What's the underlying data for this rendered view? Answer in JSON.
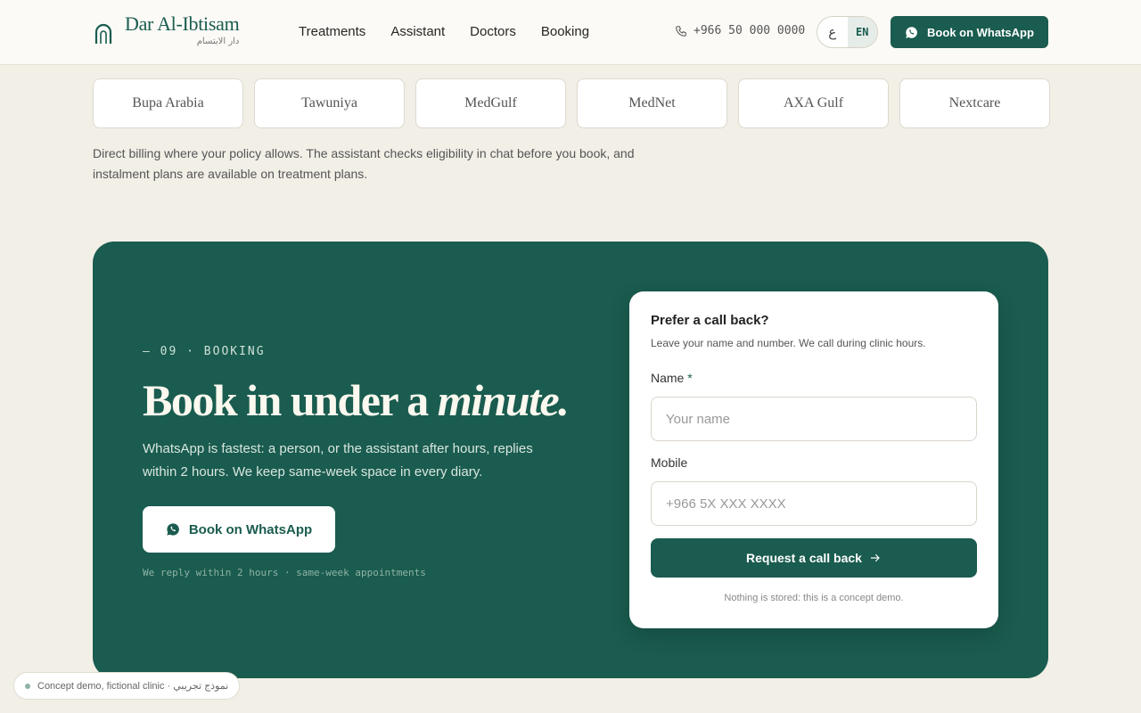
{
  "header": {
    "brand_name": "Dar Al-Ibtisam",
    "brand_name_ar": "دار الابتسام",
    "nav": [
      "Treatments",
      "Assistant",
      "Doctors",
      "Booking"
    ],
    "phone": "+966 50 000 0000",
    "lang_ar": "ع",
    "lang_en": "EN",
    "cta_label": "Book on WhatsApp"
  },
  "insurers": {
    "items": [
      "Bupa Arabia",
      "Tawuniya",
      "MedGulf",
      "MedNet",
      "AXA Gulf",
      "Nextcare"
    ],
    "note": "Direct billing where your policy allows. The assistant checks eligibility in chat before you book, and instalment plans are available on treatment plans."
  },
  "booking": {
    "eyebrow": "— 09 · BOOKING",
    "headline_pre": "Book in under a ",
    "headline_em": "minute.",
    "lede": "WhatsApp is fastest: a person, or the assistant after hours, replies within 2 hours. We keep same-week space in every diary.",
    "cta_label": "Book on WhatsApp",
    "cta_note": "We reply within 2 hours · same-week appointments"
  },
  "callback": {
    "title": "Prefer a call back?",
    "subtitle": "Leave your name and number. We call during clinic hours.",
    "name_label": "Name",
    "name_required": "*",
    "name_placeholder": "Your name",
    "mobile_label": "Mobile",
    "mobile_placeholder": "+966 5X XXX XXXX",
    "submit_label": "Request a call back",
    "note": "Nothing is stored: this is a concept demo."
  },
  "demo_badge": "Concept demo, fictional clinic · نموذج تجريبي",
  "colors": {
    "brand": "#1a5c4f",
    "background": "#f2efe7",
    "card": "#ffffff"
  },
  "icons": [
    "arch-logo-icon",
    "phone-icon",
    "whatsapp-icon",
    "arrow-right-icon"
  ]
}
